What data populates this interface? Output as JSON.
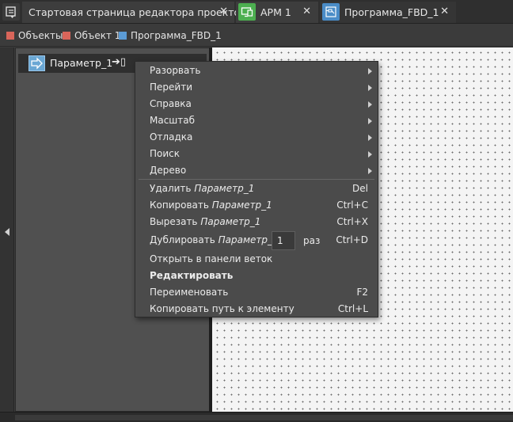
{
  "tabs": {
    "start": {
      "label": "Стартовая страница редактора проектов",
      "close": "✕"
    },
    "arm": {
      "label": "АРМ 1",
      "close": "✕"
    },
    "fbd": {
      "label": "Программа_FBD_1",
      "close": "✕"
    }
  },
  "breadcrumb": [
    {
      "label": "Объекты",
      "color": "#d9655a"
    },
    {
      "label": "Объект 1",
      "color": "#d9655a"
    },
    {
      "label": "Программа_FBD_1",
      "color": "#5b9bd5"
    }
  ],
  "tree": {
    "item_label": "Параметр_1",
    "pin_glyph": "➔▯"
  },
  "context_menu": {
    "submenus": [
      {
        "label": "Разорвать"
      },
      {
        "label": "Перейти"
      },
      {
        "label": "Справка"
      },
      {
        "label": "Масштаб"
      },
      {
        "label": "Отладка"
      },
      {
        "label": "Поиск"
      },
      {
        "label": "Дерево"
      }
    ],
    "delete": {
      "label": "Удалить",
      "target": "Параметр_1",
      "shortcut": "Del"
    },
    "copy": {
      "label": "Копировать",
      "target": "Параметр_1",
      "shortcut": "Ctrl+C"
    },
    "cut": {
      "label": "Вырезать",
      "target": "Параметр_1",
      "shortcut": "Ctrl+X"
    },
    "duplicate": {
      "label": "Дублировать",
      "target": "Параметр_1",
      "count": "1",
      "unit": "раз",
      "shortcut": "Ctrl+D"
    },
    "open_branches": {
      "label": "Открыть в панели веток"
    },
    "edit": {
      "label": "Редактировать"
    },
    "rename": {
      "label": "Переименовать",
      "shortcut": "F2"
    },
    "copy_path": {
      "label": "Копировать путь к элементу",
      "shortcut": "Ctrl+L"
    }
  },
  "colors": {
    "arm_tab_accent": "#4caf50",
    "fbd_tab_accent": "#4a8cc7",
    "tree_icon": "#6aa7d4"
  }
}
